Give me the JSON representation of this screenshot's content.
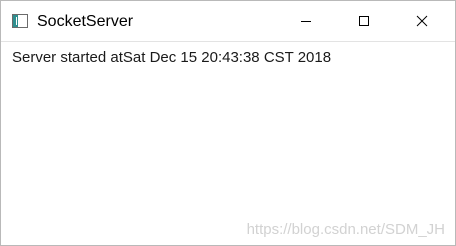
{
  "window": {
    "title": "SocketServer",
    "icon": "java-app-window-icon",
    "controls": {
      "minimize_icon": "minimize-icon",
      "maximize_icon": "maximize-icon",
      "close_icon": "close-icon"
    }
  },
  "content": {
    "log_text": "Server started atSat Dec 15 20:43:38 CST 2018"
  },
  "watermark": {
    "text": "https://blog.csdn.net/SDM_JH"
  },
  "colors": {
    "title_bar_bg": "#ffffff",
    "window_border": "#b9b9b9",
    "text": "#1a1a1a",
    "watermark": "#d2d2d2"
  }
}
